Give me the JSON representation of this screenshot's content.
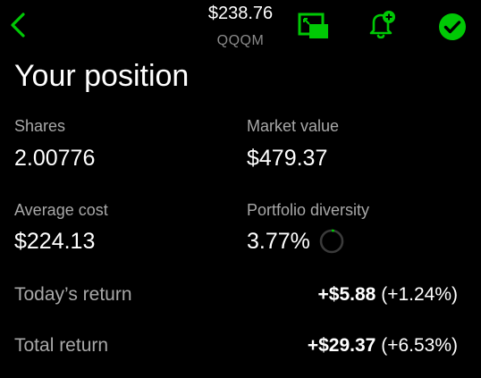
{
  "header": {
    "price": "$238.76",
    "ticker": "QQQM",
    "icons": {
      "back": "chevron-left-icon",
      "pip": "picture-in-picture-icon",
      "alert": "bell-plus-icon",
      "watchlist": "check-circle-icon"
    },
    "accent_color": "#00c805"
  },
  "position": {
    "title": "Your position",
    "shares": {
      "label": "Shares",
      "value": "2.00776"
    },
    "market_value": {
      "label": "Market value",
      "value": "$479.37"
    },
    "average_cost": {
      "label": "Average cost",
      "value": "$224.13"
    },
    "portfolio_diversity": {
      "label": "Portfolio diversity",
      "value": "3.77%",
      "fraction": 0.0377
    },
    "todays_return": {
      "label": "Today’s return",
      "amount": "+$5.88",
      "percent": "(+1.24%)"
    },
    "total_return": {
      "label": "Total return",
      "amount": "+$29.37",
      "percent": "(+6.53%)"
    }
  }
}
